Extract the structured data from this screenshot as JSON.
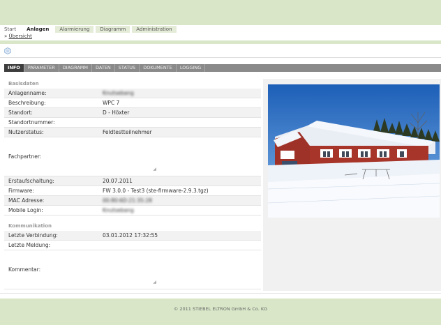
{
  "topnav": {
    "tabs": [
      {
        "label": "Start"
      },
      {
        "label": "Anlagen"
      },
      {
        "label": "Alarmierung"
      },
      {
        "label": "Diagramm"
      },
      {
        "label": "Administration"
      }
    ]
  },
  "breadcrumb": {
    "prefix": "»",
    "link": "Übersicht"
  },
  "subnav": {
    "tabs": [
      {
        "label": "INFO"
      },
      {
        "label": "PARAMETER"
      },
      {
        "label": "DIAGRAMM"
      },
      {
        "label": "DATEN"
      },
      {
        "label": "STATUS"
      },
      {
        "label": "DOKUMENTE"
      },
      {
        "label": "LOGGING"
      }
    ]
  },
  "basisdaten": {
    "title": "Basisdaten",
    "rows": [
      {
        "label": "Anlagenname:",
        "value": "Knutsebang"
      },
      {
        "label": "Beschreibung:",
        "value": "WPC 7"
      },
      {
        "label": "Standort:",
        "value": "D - Höxter"
      },
      {
        "label": "Standortnummer:",
        "value": ""
      },
      {
        "label": "Nutzerstatus:",
        "value": "Feldtestteilnehmer"
      },
      {
        "label": "Fachpartner:",
        "value": ""
      },
      {
        "label": "Erstaufschaltung:",
        "value": "20.07.2011"
      },
      {
        "label": "Firmware:",
        "value": "FW 3.0.0 - Test3 (ste-firmware-2.9.3.tgz)"
      },
      {
        "label": "MAC Adresse:",
        "value": "00:80:6D:21:35:28"
      },
      {
        "label": "Mobile Login:",
        "value": "Knutsebang"
      }
    ]
  },
  "kommunikation": {
    "title": "Kommunikation",
    "rows": [
      {
        "label": "Letzte Verbindung:",
        "value": "03.01.2012 17:32:55"
      },
      {
        "label": "Letzte Meldung:",
        "value": ""
      },
      {
        "label": "Kommentar:",
        "value": ""
      }
    ]
  },
  "footer": {
    "text": "© 2011 STIEBEL ELTRON GmbH & Co. KG"
  }
}
